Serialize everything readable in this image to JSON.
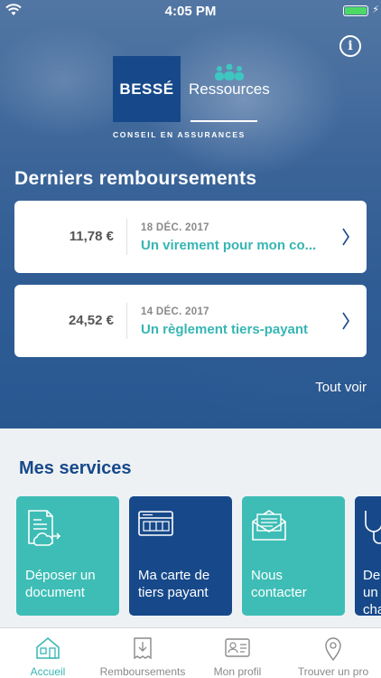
{
  "status_bar": {
    "time": "4:05 PM"
  },
  "logo": {
    "brand": "BESSÉ",
    "product": "Ressources",
    "tagline": "CONSEIL EN ASSURANCES"
  },
  "header": {
    "info_icon": "info-icon"
  },
  "reimbursements": {
    "title": "Derniers remboursements",
    "items": [
      {
        "amount": "11,78 €",
        "date": "18 DÉC. 2017",
        "label": "Un virement pour mon co..."
      },
      {
        "amount": "24,52 €",
        "date": "14 DÉC. 2017",
        "label": "Un règlement tiers-payant"
      }
    ],
    "see_all": "Tout voir"
  },
  "services": {
    "title": "Mes services",
    "items": [
      {
        "label": "Déposer un document",
        "icon": "upload-document-icon",
        "color": "#3dbdb5"
      },
      {
        "label": "Ma carte de tiers payant",
        "icon": "card-icon",
        "color": "#17498a"
      },
      {
        "label": "Nous contacter",
        "icon": "mail-icon",
        "color": "#3dbdb5"
      },
      {
        "label": "De un cha",
        "icon": "stethoscope-icon",
        "color": "#17498a"
      }
    ]
  },
  "tabbar": {
    "tabs": [
      {
        "label": "Accueil",
        "icon": "home-icon",
        "active": true
      },
      {
        "label": "Remboursements",
        "icon": "receipt-icon",
        "active": false
      },
      {
        "label": "Mon profil",
        "icon": "profile-card-icon",
        "active": false
      },
      {
        "label": "Trouver un pro",
        "icon": "location-pin-icon",
        "active": false
      }
    ]
  },
  "colors": {
    "primary": "#17498a",
    "accent": "#36b6b3",
    "teal_tile": "#3dbdb5"
  }
}
